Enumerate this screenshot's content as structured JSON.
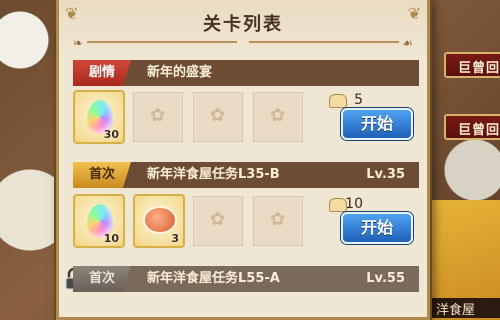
{
  "panel": {
    "title": "关卡列表"
  },
  "side_buttons": [
    "巨曾回",
    "巨曾回"
  ],
  "side_shop_label": "洋食屋",
  "stages": [
    {
      "tag": "剧情",
      "tag_style": "red",
      "name": "新年的盛宴",
      "level": "",
      "locked": false,
      "rewards": [
        {
          "type": "rainbow-gem",
          "count": "30"
        }
      ],
      "cost_icon": "bread-icon",
      "cost": "5",
      "button": "开始"
    },
    {
      "tag": "首次",
      "tag_style": "gold",
      "name": "新年洋食屋任务L35-B",
      "level": "Lv.35",
      "locked": false,
      "rewards": [
        {
          "type": "rainbow-gem",
          "count": "10"
        },
        {
          "type": "fish-dish",
          "count": "3"
        }
      ],
      "cost_icon": "bread-icon",
      "cost": "10",
      "button": "开始"
    },
    {
      "tag": "首次",
      "tag_style": "grey",
      "name": "新年洋食屋任务L55-A",
      "level": "Lv.55",
      "locked": true
    }
  ],
  "colors": {
    "panel_bg": "#efe6d4",
    "row_bg": "#6c4c33",
    "button_blue": "#1f5fb8",
    "tag_red": "#c0392b",
    "tag_gold": "#e0a834"
  }
}
